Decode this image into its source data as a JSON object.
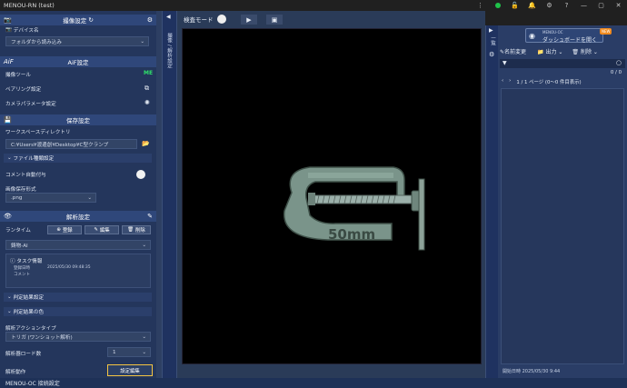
{
  "app": {
    "title": "MENOU-RN (test)"
  },
  "left": {
    "capture": {
      "header": "撮像設定",
      "device_label": "デバイス名",
      "device_value": "フォルダから読み込み"
    },
    "aif": {
      "prefix": "AiF",
      "header": "AiF設定",
      "rows": [
        "撮像ツール",
        "ペアリング設定",
        "カメラパラメータ設定"
      ],
      "badge": "ME"
    },
    "save": {
      "header": "保存設定",
      "workspace_label": "ワークスペースディレクトリ",
      "workspace_value": "C:¥Users¥渡邊創¥Desktop¥C型クランプ",
      "file_header": "ファイル種類設定",
      "comment_auto": "コメント自動付与",
      "image_format_label": "画像保存形式",
      "image_format_value": ".png"
    },
    "analysis": {
      "header": "解析設定",
      "runtime_label": "ランタイム",
      "register": "登録",
      "edit": "編集",
      "delete": "削除",
      "model": "鋳物-AI",
      "task_title": "タスク情報",
      "task_date_label": "登録日時",
      "task_date": "2025/05/30 09:48:35",
      "task_comment_label": "コメント",
      "result_header": "判定結果設定",
      "result_color": "判定結果の色",
      "action_type_label": "解析アクションタイプ",
      "action_type_value": "トリガ (ワンショット解析)",
      "loader_label": "解析器ロード数",
      "loader_value": "1",
      "run_label": "解析動作",
      "settings_edit": "設定編集",
      "oc_label": "MENOU-OC 接続設定"
    }
  },
  "vstrip": {
    "label": "撮像 / 解析設定"
  },
  "toolbar": {
    "mode_label": "検査モード"
  },
  "canvas": {
    "text": "50mm"
  },
  "right": {
    "vlabel": "一覧",
    "oc_small": "MENOU-OC",
    "dashboard": "ダッシュボードを開く",
    "new_badge": "NEW",
    "rename": "名前変更",
    "output": "出力",
    "delete": "削除",
    "count": "0 / 0",
    "pager": "1 / 1 ページ  (0〜0 件目表示)",
    "start_date": "開始日時 2025/05/30 9:44"
  },
  "colors": {
    "accent": "#f5c542",
    "header": "#2f477a",
    "green": "#1fc24a"
  }
}
